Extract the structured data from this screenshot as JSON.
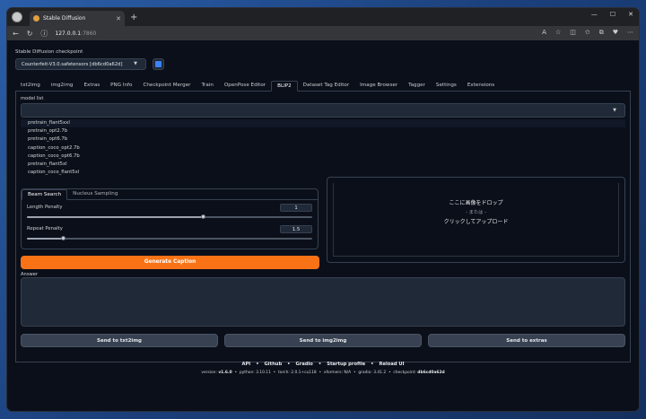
{
  "browser": {
    "tab_title": "Stable Diffusion",
    "tab_close": "✕",
    "new_tab": "+",
    "url_host": "127.0.0.1",
    "url_port": ":7860",
    "controls": {
      "minimize": "—",
      "maximize": "☐",
      "close": "✕"
    }
  },
  "checkpoint": {
    "label": "Stable Diffusion checkpoint",
    "value": "Counterfeit-V3.0.safetensors [db6cd0a62d]"
  },
  "tabs": [
    "txt2img",
    "img2img",
    "Extras",
    "PNG Info",
    "Checkpoint Merger",
    "Train",
    "OpenPose Editor",
    "BLIP2",
    "Dataset Tag Editor",
    "Image Browser",
    "Tagger",
    "Settings",
    "Extensions"
  ],
  "active_tab": "BLIP2",
  "model_list": {
    "label": "model list",
    "options": [
      "pretrain_flant5xxl",
      "pretrain_opt2.7b",
      "pretrain_opt6.7b",
      "caption_coco_opt2.7b",
      "caption_coco_opt6.7b",
      "pretrain_flant5xl",
      "caption_coco_flant5xl"
    ]
  },
  "subtabs": [
    "Beam Search",
    "Nucleus Sampling"
  ],
  "length_penalty": {
    "label": "Length Penalty",
    "value": "1",
    "fraction": 0.62
  },
  "repeat_penalty": {
    "label": "Repeat Penalty",
    "value": "1.5",
    "fraction": 0.13
  },
  "dropzone": {
    "line1": "ここに画像をドロップ",
    "or": "- または -",
    "line2": "クリックしてアップロード"
  },
  "generate_label": "Generate Caption",
  "answer_label": "Answer",
  "send_buttons": [
    "Send to txt2img",
    "Send to img2img",
    "Send to extras"
  ],
  "footer": {
    "links": [
      "API",
      "Github",
      "Gradio",
      "Startup profile",
      "Reload UI"
    ],
    "version_label": "version:",
    "version": "v1.6.0",
    "python": "python: 3.10.11",
    "torch": "torch: 2.0.1+cu118",
    "xformers": "xformers: N/A",
    "gradio": "gradio: 3.41.2",
    "checkpoint_label": "checkpoint:",
    "checkpoint": "db6cd0a62d"
  },
  "colors": {
    "accent": "#f97316",
    "bg": "#0b0f19"
  }
}
